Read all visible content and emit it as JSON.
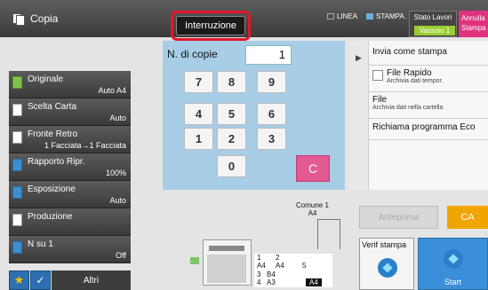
{
  "topbar": {
    "app_title": "Copia",
    "interrupt_label": "Interruzione",
    "linea_label": "LINEA",
    "stampa_label": "STAMPA.",
    "stato_lavori_label": "Stato Lavori",
    "vassoio_label": "Vassoio 1",
    "annulla_line1": "Annulla",
    "annulla_line2": "Stampa"
  },
  "settings": [
    {
      "label": "Originale",
      "value": "Auto A4",
      "icon": "original-icon"
    },
    {
      "label": "Scelta Carta",
      "value": "Auto",
      "icon": "paper-icon"
    },
    {
      "label": "Fronte Retro",
      "value": "1 Facciata→1 Facciata",
      "icon": "duplex-icon"
    },
    {
      "label": "Rapporto Ripr.",
      "value": "100%",
      "icon": "ratio-icon"
    },
    {
      "label": "Esposizione",
      "value": "Auto",
      "icon": "exposure-icon"
    },
    {
      "label": "Produzione",
      "value": "",
      "icon": "output-icon"
    },
    {
      "label": "N su 1",
      "value": "Off",
      "icon": "n-up-icon"
    }
  ],
  "bottom_left": {
    "altri_label": "Altri"
  },
  "keypad": {
    "copies_label": "N. di copie",
    "copies_value": "1",
    "keys": [
      "7",
      "8",
      "9",
      "4",
      "5",
      "6",
      "1",
      "2",
      "3",
      "0"
    ],
    "clear_label": "C"
  },
  "right_menu": {
    "invia": "Invia come stampa",
    "file_rapido": "File Rapido",
    "file_rapido_sub": "Archivia dati tempor.",
    "file": "File",
    "file_sub": "Archivia dati nella cartella",
    "eco": "Richiama programma Eco"
  },
  "controls": {
    "preview_label": "Anteprima",
    "ca_label": "CA",
    "verif_label": "Verif stampa",
    "start_label": "Start"
  },
  "machine": {
    "comune_line1": "Comune 1",
    "comune_line2": "A4",
    "tray_rows": [
      {
        "left_num": "1",
        "left_size": "A4",
        "right_num": "2",
        "right_size": "A4"
      },
      {
        "left_num": "3",
        "left_size": "B4",
        "right_num": "",
        "right_size": ""
      },
      {
        "left_num": "4",
        "left_size": "A3",
        "right_num": "",
        "right_size": ""
      }
    ],
    "side_tray_num": "5",
    "side_tray_size": "A4"
  },
  "colors": {
    "keypad_bg": "#a8cde6",
    "accent_red": "#e5162b",
    "ca_orange": "#f0a500",
    "start_blue": "#3a8fd8",
    "clear_pink": "#e35a93"
  }
}
